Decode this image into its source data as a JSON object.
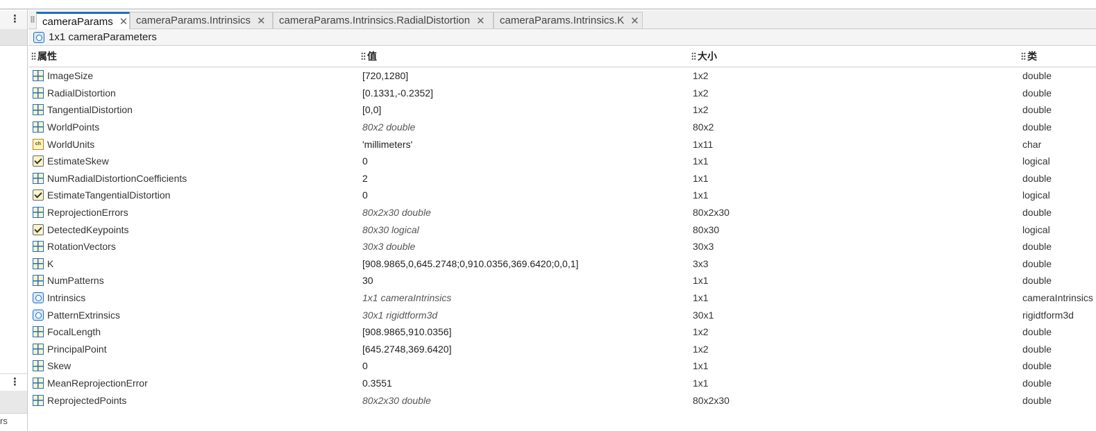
{
  "left_panel": {
    "fragment_text": "rs"
  },
  "tabs": [
    {
      "label": "cameraParams",
      "active": true
    },
    {
      "label": "cameraParams.Intrinsics",
      "active": false
    },
    {
      "label": "cameraParams.Intrinsics.RadialDistortion",
      "active": false
    },
    {
      "label": "cameraParams.Intrinsics.K",
      "active": false
    }
  ],
  "close_glyph": "✕",
  "variable_header": {
    "label": "1x1 cameraParameters"
  },
  "columns": {
    "name": "属性",
    "value": "值",
    "size": "大小",
    "class": "类"
  },
  "rows": [
    {
      "icon": "matrix-icon",
      "name": "ImageSize",
      "value": "[720,1280]",
      "size": "1x2",
      "class": "double",
      "italic": false
    },
    {
      "icon": "matrix-icon",
      "name": "RadialDistortion",
      "value": "[0.1331,-0.2352]",
      "size": "1x2",
      "class": "double",
      "italic": false
    },
    {
      "icon": "matrix-icon",
      "name": "TangentialDistortion",
      "value": "[0,0]",
      "size": "1x2",
      "class": "double",
      "italic": false
    },
    {
      "icon": "matrix-icon",
      "name": "WorldPoints",
      "value": "80x2 double",
      "size": "80x2",
      "class": "double",
      "italic": true
    },
    {
      "icon": "char-icon",
      "name": "WorldUnits",
      "value": "'millimeters'",
      "size": "1x11",
      "class": "char",
      "italic": false
    },
    {
      "icon": "checkbox-icon",
      "name": "EstimateSkew",
      "value": "0",
      "size": "1x1",
      "class": "logical",
      "italic": false
    },
    {
      "icon": "matrix-icon",
      "name": "NumRadialDistortionCoefficients",
      "value": "2",
      "size": "1x1",
      "class": "double",
      "italic": false
    },
    {
      "icon": "checkbox-icon",
      "name": "EstimateTangentialDistortion",
      "value": "0",
      "size": "1x1",
      "class": "logical",
      "italic": false
    },
    {
      "icon": "matrix-icon",
      "name": "ReprojectionErrors",
      "value": "80x2x30 double",
      "size": "80x2x30",
      "class": "double",
      "italic": true
    },
    {
      "icon": "checkbox-icon",
      "name": "DetectedKeypoints",
      "value": "80x30 logical",
      "size": "80x30",
      "class": "logical",
      "italic": true
    },
    {
      "icon": "matrix-icon",
      "name": "RotationVectors",
      "value": "30x3 double",
      "size": "30x3",
      "class": "double",
      "italic": true
    },
    {
      "icon": "matrix-icon",
      "name": "K",
      "value": "[908.9865,0,645.2748;0,910.0356,369.6420;0,0,1]",
      "size": "3x3",
      "class": "double",
      "italic": false
    },
    {
      "icon": "matrix-icon",
      "name": "NumPatterns",
      "value": "30",
      "size": "1x1",
      "class": "double",
      "italic": false
    },
    {
      "icon": "object-icon",
      "name": "Intrinsics",
      "value": "1x1 cameraIntrinsics",
      "size": "1x1",
      "class": "cameraIntrinsics",
      "italic": true
    },
    {
      "icon": "object-icon",
      "name": "PatternExtrinsics",
      "value": "30x1 rigidtform3d",
      "size": "30x1",
      "class": "rigidtform3d",
      "italic": true
    },
    {
      "icon": "matrix-icon",
      "name": "FocalLength",
      "value": "[908.9865,910.0356]",
      "size": "1x2",
      "class": "double",
      "italic": false
    },
    {
      "icon": "matrix-icon",
      "name": "PrincipalPoint",
      "value": "[645.2748,369.6420]",
      "size": "1x2",
      "class": "double",
      "italic": false
    },
    {
      "icon": "matrix-icon",
      "name": "Skew",
      "value": "0",
      "size": "1x1",
      "class": "double",
      "italic": false
    },
    {
      "icon": "matrix-icon",
      "name": "MeanReprojectionError",
      "value": "0.3551",
      "size": "1x1",
      "class": "double",
      "italic": false
    },
    {
      "icon": "matrix-icon",
      "name": "ReprojectedPoints",
      "value": "80x2x30 double",
      "size": "80x2x30",
      "class": "double",
      "italic": true
    }
  ],
  "colors": {
    "accent": "#1f6fc4",
    "icon_fill": "#fdf3c4"
  }
}
